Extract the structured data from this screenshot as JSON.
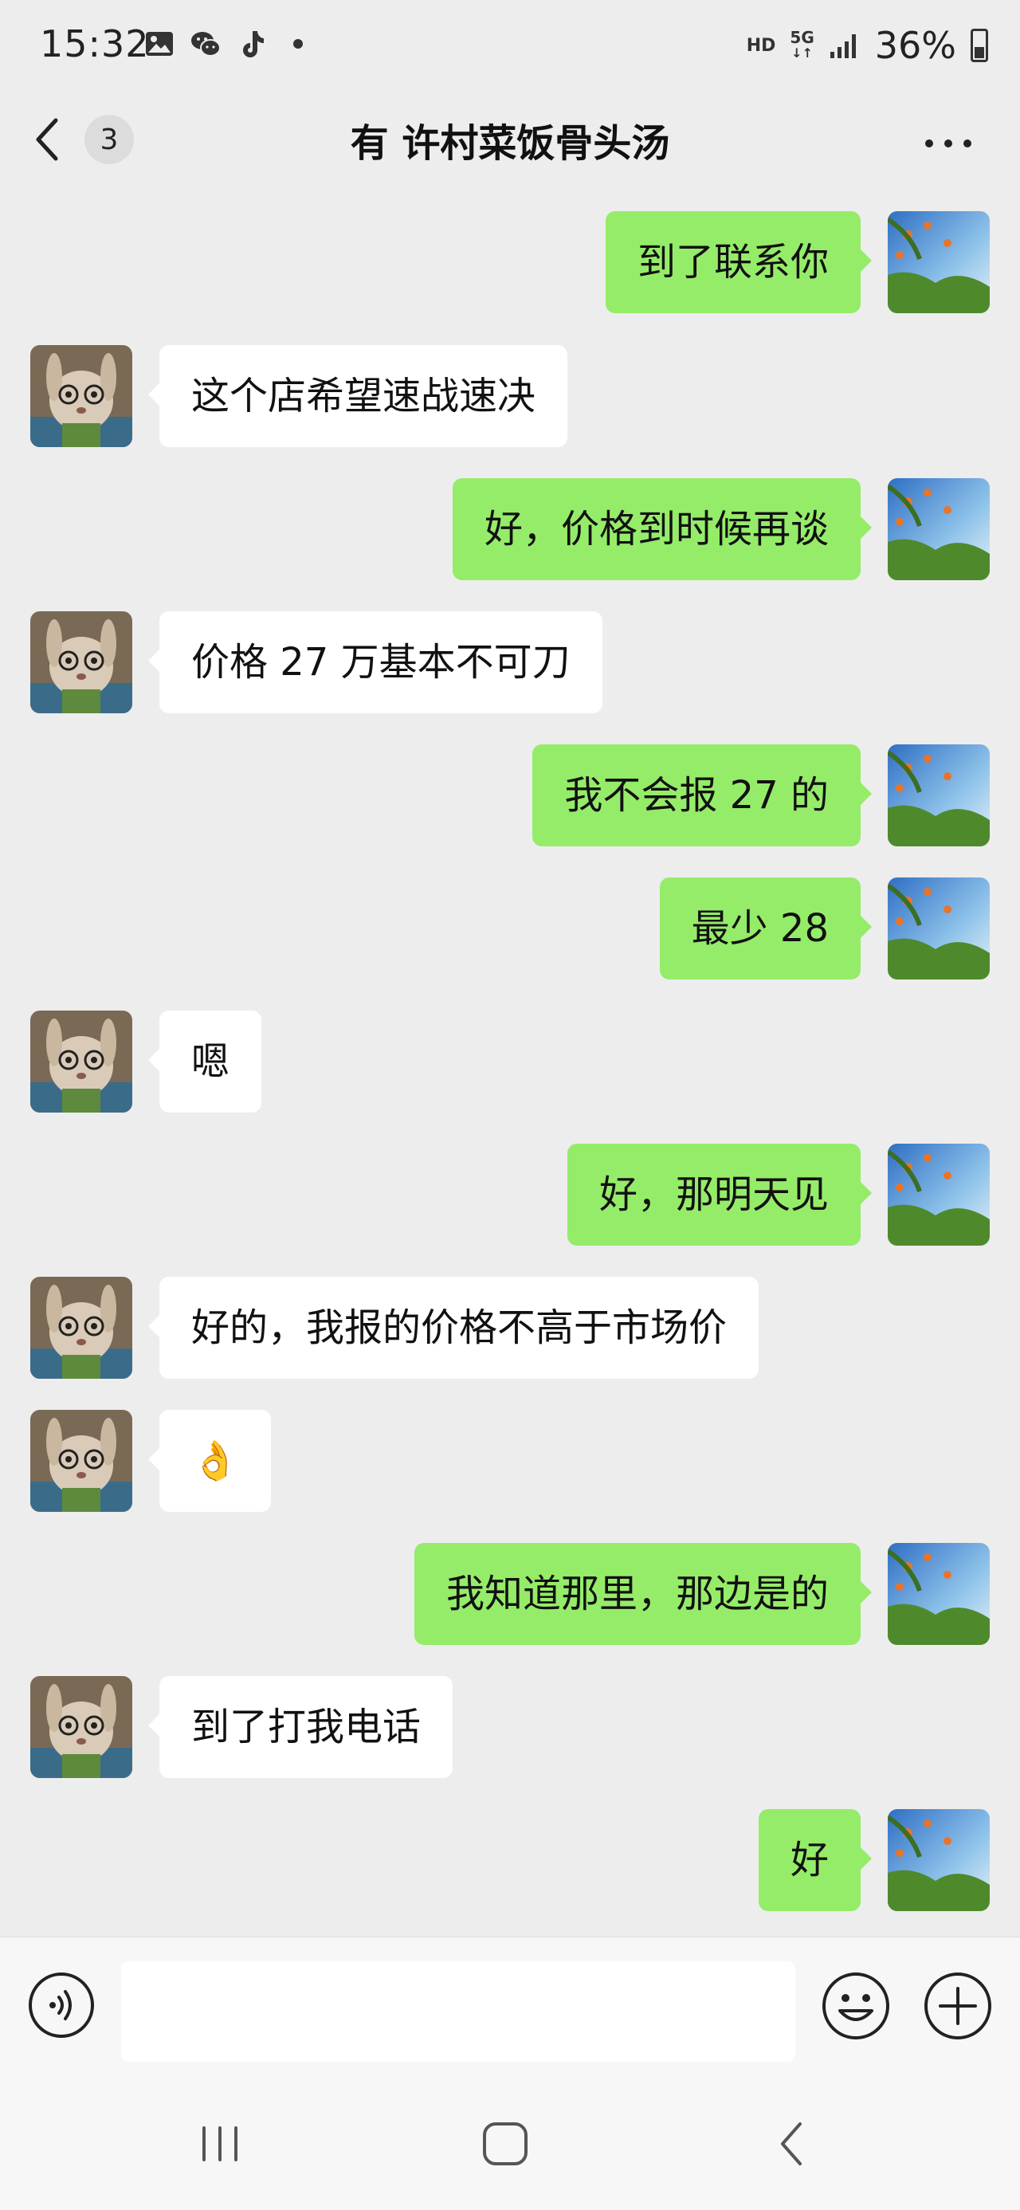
{
  "status_bar": {
    "time": "15:32",
    "hd": "HD",
    "network": "5G",
    "battery": "36%",
    "icons": [
      "gallery-icon",
      "wechat-icon",
      "tiktok-icon",
      "dot-icon",
      "signal-icon",
      "battery-icon"
    ]
  },
  "nav": {
    "unread_count": "3",
    "title": "有 许村菜饭骨头汤",
    "icons": [
      "back-chevron-icon",
      "more-dots-icon"
    ]
  },
  "messages": [
    {
      "side": "out",
      "text": "到了联系你"
    },
    {
      "side": "in",
      "text": "这个店希望速战速决"
    },
    {
      "side": "out",
      "text": "好，价格到时候再谈"
    },
    {
      "side": "in",
      "text": "价格 27 万基本不可刀"
    },
    {
      "side": "out",
      "text": "我不会报 27 的"
    },
    {
      "side": "out",
      "text": "最少 28"
    },
    {
      "side": "in",
      "text": "嗯"
    },
    {
      "side": "out",
      "text": "好，那明天见"
    },
    {
      "side": "in",
      "text": "好的，我报的价格不高于市场价"
    },
    {
      "side": "in",
      "text": "👌"
    },
    {
      "side": "out",
      "text": "我知道那里，那边是的"
    },
    {
      "side": "in",
      "text": "到了打我电话"
    },
    {
      "side": "out",
      "text": "好"
    }
  ],
  "input_bar": {
    "placeholder": "",
    "icons": [
      "voice-icon",
      "emoji-icon",
      "plus-icon"
    ]
  },
  "system_nav": {
    "icons": [
      "recents-icon",
      "home-icon",
      "back-icon"
    ]
  },
  "colors": {
    "background": "#ededed",
    "outgoing_bubble": "#95ec69",
    "incoming_bubble": "#ffffff"
  }
}
